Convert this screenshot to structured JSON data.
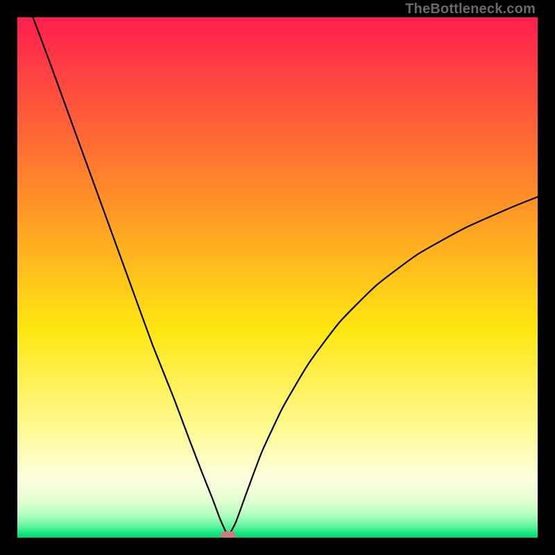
{
  "watermark": "TheBottleneck.com",
  "chart_data": {
    "type": "line",
    "title": "",
    "xlabel": "",
    "ylabel": "",
    "xlim": [
      0,
      100
    ],
    "ylim": [
      0,
      100
    ],
    "grid": false,
    "legend": false,
    "annotations": [],
    "minimum_marker": {
      "x": 40.5,
      "y": 0
    },
    "gradient_stops": [
      {
        "pos": 0.0,
        "color": "#ff1f4f"
      },
      {
        "pos": 0.33,
        "color": "#ff8a2a"
      },
      {
        "pos": 0.6,
        "color": "#ffe712"
      },
      {
        "pos": 0.8,
        "color": "#fffb9a"
      },
      {
        "pos": 0.885,
        "color": "#fdffe0"
      },
      {
        "pos": 0.925,
        "color": "#e8ffd3"
      },
      {
        "pos": 0.955,
        "color": "#b6ffbf"
      },
      {
        "pos": 0.975,
        "color": "#6df7a7"
      },
      {
        "pos": 0.992,
        "color": "#16e77f"
      },
      {
        "pos": 1.0,
        "color": "#05d66e"
      }
    ],
    "series": [
      {
        "name": "bottleneck-curve",
        "x": [
          0,
          3,
          6,
          10,
          14,
          18,
          22,
          26,
          30,
          33,
          35.5,
          37.5,
          39,
          40.5,
          42,
          44,
          47,
          51,
          56,
          62,
          69,
          77,
          86,
          95,
          100
        ],
        "values": [
          108,
          100,
          92,
          81,
          70,
          59,
          48,
          37,
          27,
          19,
          12.5,
          7.5,
          3.5,
          0.5,
          3,
          8.5,
          16.5,
          25,
          33.5,
          41.5,
          48.5,
          54.5,
          59.5,
          63.5,
          65.5
        ]
      }
    ]
  }
}
